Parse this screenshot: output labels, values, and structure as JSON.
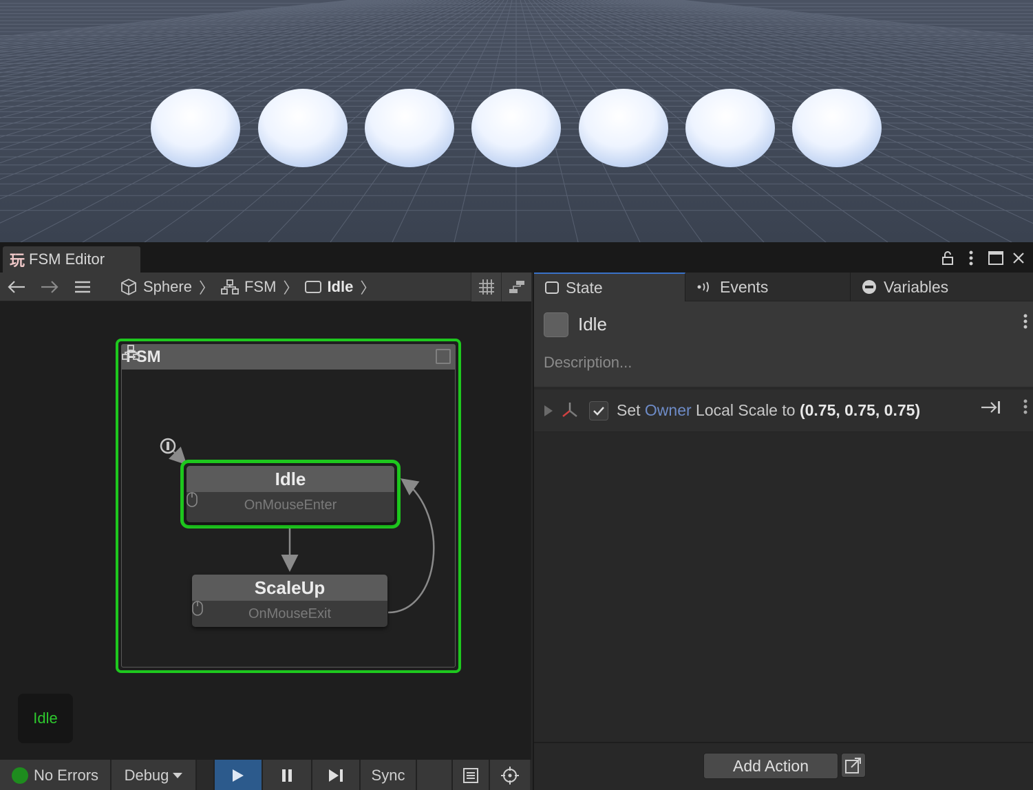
{
  "window": {
    "title": "FSM Editor",
    "app_icon": "玩",
    "controls": [
      "lock-icon",
      "more-icon",
      "maximize-icon",
      "close-icon"
    ]
  },
  "toolbar": {
    "back_icon": "←",
    "forward_icon": "→",
    "menu_icon": "☰",
    "breadcrumb": [
      {
        "label": "Sphere",
        "icon": "cube-icon"
      },
      {
        "label": "FSM",
        "icon": "hierarchy-icon"
      },
      {
        "label": "Idle",
        "icon": "state-icon"
      }
    ],
    "separator": "〉"
  },
  "graph": {
    "group_title": "FSM",
    "states": [
      {
        "name": "Idle",
        "transition": "OnMouseEnter",
        "selected": true
      },
      {
        "name": "ScaleUp",
        "transition": "OnMouseExit",
        "selected": false
      }
    ],
    "current_state": "Idle"
  },
  "statusbar": {
    "errors": "No Errors",
    "mode": "Debug",
    "sync": "Sync"
  },
  "inspector": {
    "tabs": [
      {
        "label": "State",
        "icon": "square-icon",
        "active": true
      },
      {
        "label": "Events",
        "icon": "broadcast-icon",
        "active": false
      },
      {
        "label": "Variables",
        "icon": "minus-circle-icon",
        "active": false
      }
    ],
    "state_name": "Idle",
    "description_placeholder": "Description...",
    "action": {
      "prefix": "Set ",
      "target": "Owner",
      "middle": " Local Scale to ",
      "value": "(0.75, 0.75, 0.75)",
      "enabled": true
    },
    "add_action": "Add Action"
  },
  "colors": {
    "selection_green": "#1ec81e",
    "accent_blue": "#3a72c8",
    "owner_blue": "#6e8cc8",
    "play_button": "#2c5a8c"
  }
}
